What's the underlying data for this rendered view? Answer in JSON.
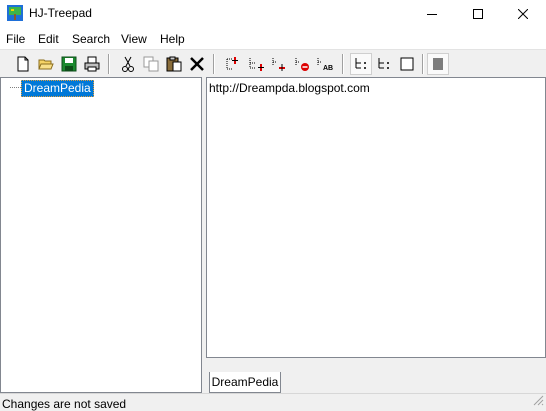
{
  "window": {
    "title": "HJ-Treepad"
  },
  "menu": [
    "File",
    "Edit",
    "Search",
    "View",
    "Help"
  ],
  "toolbar": {
    "buttons": [
      {
        "name": "new-file-icon"
      },
      {
        "name": "open-folder-icon"
      },
      {
        "name": "save-icon"
      },
      {
        "name": "print-icon"
      },
      {
        "name": "cut-icon"
      },
      {
        "name": "copy-icon"
      },
      {
        "name": "paste-icon"
      },
      {
        "name": "delete-icon"
      },
      {
        "name": "add-node-icon"
      },
      {
        "name": "add-child-node-icon"
      },
      {
        "name": "insert-node-icon"
      },
      {
        "name": "delete-node-icon"
      },
      {
        "name": "sort-nodes-icon"
      },
      {
        "name": "tree-view-icon"
      },
      {
        "name": "tree-view-alt-icon"
      },
      {
        "name": "article-view-icon"
      },
      {
        "name": "word-wrap-icon"
      }
    ]
  },
  "tree": {
    "nodes": [
      {
        "label": "DreamPedia",
        "selected": true
      }
    ]
  },
  "editor": {
    "content": "http://Dreampda.blogspot.com"
  },
  "tabs": [
    {
      "label": "DreamPedia",
      "active": true
    }
  ],
  "status": {
    "text": "Changes are not saved"
  },
  "colors": {
    "selection": "#0078d7",
    "chrome": "#f0f0f0",
    "border": "#828790"
  }
}
